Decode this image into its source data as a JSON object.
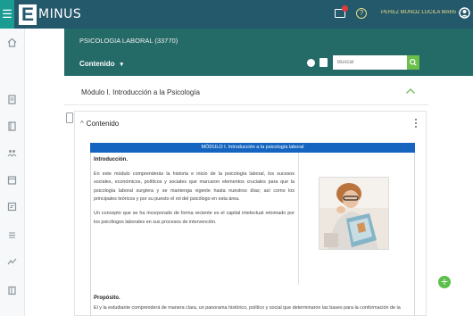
{
  "brand": {
    "logo_letter": "E",
    "logo_text": "MINUS",
    "color": "#24586b",
    "accent": "#1a9c93"
  },
  "topbar": {
    "username": "PEREZ MUÑOZ LUCILA MARIA",
    "mail_icon": "mail-icon",
    "help_icon": "help-icon",
    "user_icon": "user-icon"
  },
  "course": {
    "title": "PSICOLOGIA LABORAL (33770)",
    "tab_label": "Contenido",
    "search_placeholder": "Buscar",
    "bar_color": "#246a67"
  },
  "sidebar": {
    "items": [
      {
        "icon": "home-icon"
      },
      {
        "icon": "dashboard-icon",
        "active": true
      },
      {
        "icon": "document-icon"
      },
      {
        "icon": "book-icon"
      },
      {
        "icon": "people-icon"
      },
      {
        "icon": "calendar-icon"
      },
      {
        "icon": "grades-icon"
      },
      {
        "icon": "list-icon"
      },
      {
        "icon": "activity-icon"
      },
      {
        "icon": "files-icon"
      }
    ]
  },
  "module": {
    "title": "Módulo I. Introducción a la Psicología"
  },
  "card": {
    "heading": "Contenido",
    "banner": "MÓDULO I. Introducción a la psicología laboral",
    "intro_heading": "Introducción.",
    "para1": "En este módulo comprenderás la historia e inicio de la psicología laboral, los sucesos sociales, económicos, políticos y sociales que marcaron elementos cruciales para que la psicología laboral surgiera y se mantenga vigente hasta nuestros días; así como los principales teóricos y por su puesto el rol del psicólogo en esta área.",
    "para2": "Un concepto que se ha incorporado de forma reciente es el capital intelectual retomado por los psicólogos laborales en sus procesos de intervención.",
    "prop_heading": "Propósito.",
    "prop_text": "El y la estudiante comprenderá de manera clara, un panorama histórico, político y social que determinaron las bases para la conformación de la"
  },
  "fab": {
    "label": "+",
    "color": "#5cbe4c"
  }
}
